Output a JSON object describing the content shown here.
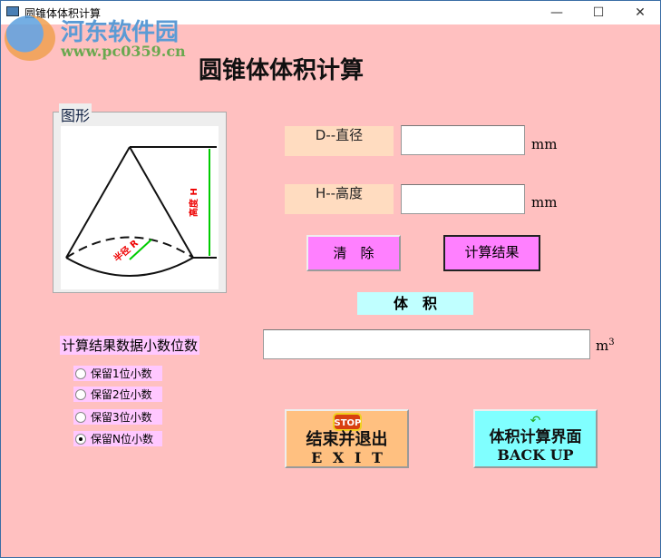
{
  "window": {
    "title": "圆锥体体积计算",
    "min": "—",
    "max": "☐",
    "close": "✕"
  },
  "watermark": {
    "name": "河东软件园",
    "url": "www.pc0359.cn"
  },
  "heading": "圆锥体体积计算",
  "figure": {
    "group_label": "图形",
    "height_label": "高度 H",
    "radius_label": "半径 R"
  },
  "inputs": {
    "diameter_label": "D--直径",
    "diameter_value": "",
    "height_label": "H--高度",
    "height_value": "",
    "unit": "mm"
  },
  "buttons": {
    "clear": "清　除",
    "compute": "计算结果",
    "exit_line1": "结束并退出",
    "exit_line2": "E X I T",
    "stop_text": "STOP",
    "back_line1": "体积计算界面",
    "back_line2": "BACK UP"
  },
  "result": {
    "label": "体　积",
    "value": "",
    "unit": "m",
    "unit_sup": "3"
  },
  "decimals": {
    "label": "计算结果数据小数位数",
    "options": [
      "保留1位小数",
      "保留2位小数",
      "保留3位小数",
      "保留N位小数"
    ],
    "selected": 3
  }
}
